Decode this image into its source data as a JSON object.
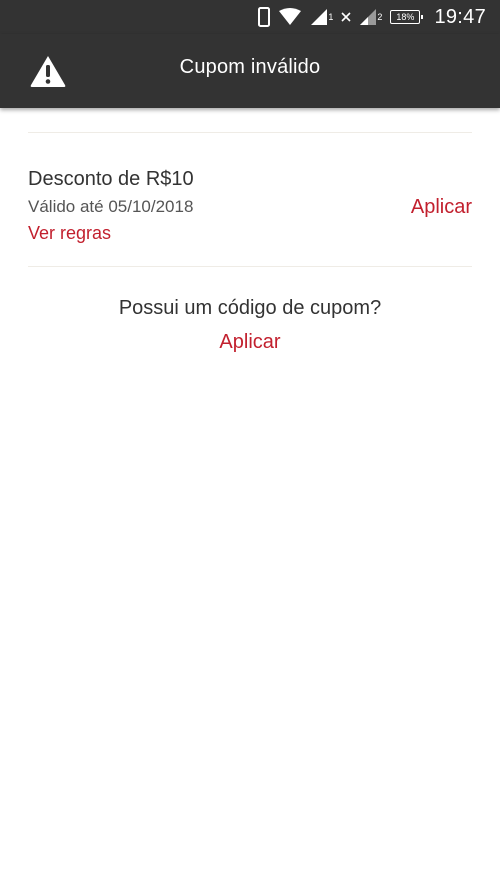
{
  "status_bar": {
    "battery": "18%",
    "sim1": "1",
    "sim2": "2",
    "time": "19:47"
  },
  "app_bar": {
    "title": "Cupom inválido",
    "icon": "warning-icon"
  },
  "coupon": {
    "title": "Desconto de R$10",
    "validity": "Válido até 05/10/2018",
    "rules_link": "Ver regras",
    "apply_label": "Aplicar"
  },
  "code_section": {
    "question": "Possui um código de cupom?",
    "apply_label": "Aplicar"
  },
  "colors": {
    "bar_background": "#333333",
    "accent": "#c2202e",
    "text": "#333333",
    "divider": "#efece6"
  }
}
